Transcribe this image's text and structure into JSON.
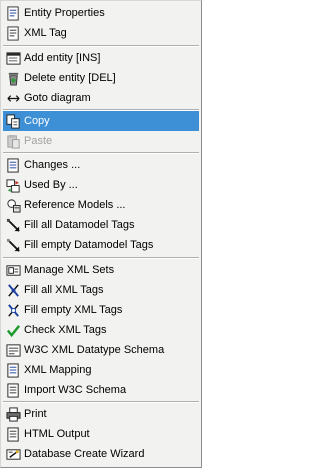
{
  "menu": {
    "items": [
      {
        "label": "Entity Properties"
      },
      {
        "label": "XML Tag"
      },
      {
        "label": "Add entity [INS]"
      },
      {
        "label": "Delete entity [DEL]"
      },
      {
        "label": "Goto diagram"
      },
      {
        "label": "Copy",
        "state": "highlighted"
      },
      {
        "label": "Paste",
        "state": "disabled"
      },
      {
        "label": "Changes ..."
      },
      {
        "label": "Used By ..."
      },
      {
        "label": "Reference Models ..."
      },
      {
        "label": "Fill all Datamodel Tags"
      },
      {
        "label": "Fill empty Datamodel Tags"
      },
      {
        "label": "Manage XML Sets"
      },
      {
        "label": "Fill all XML Tags"
      },
      {
        "label": "Fill empty XML Tags"
      },
      {
        "label": "Check XML Tags"
      },
      {
        "label": "W3C XML Datatype Schema"
      },
      {
        "label": "XML Mapping"
      },
      {
        "label": "Import W3C Schema"
      },
      {
        "label": "Print"
      },
      {
        "label": "HTML Output"
      },
      {
        "label": "Database Create Wizard"
      }
    ]
  },
  "colors": {
    "highlight": "#3d8fd6",
    "menu_background": "#f2f2f0",
    "disabled_text": "#a3a3a3"
  }
}
